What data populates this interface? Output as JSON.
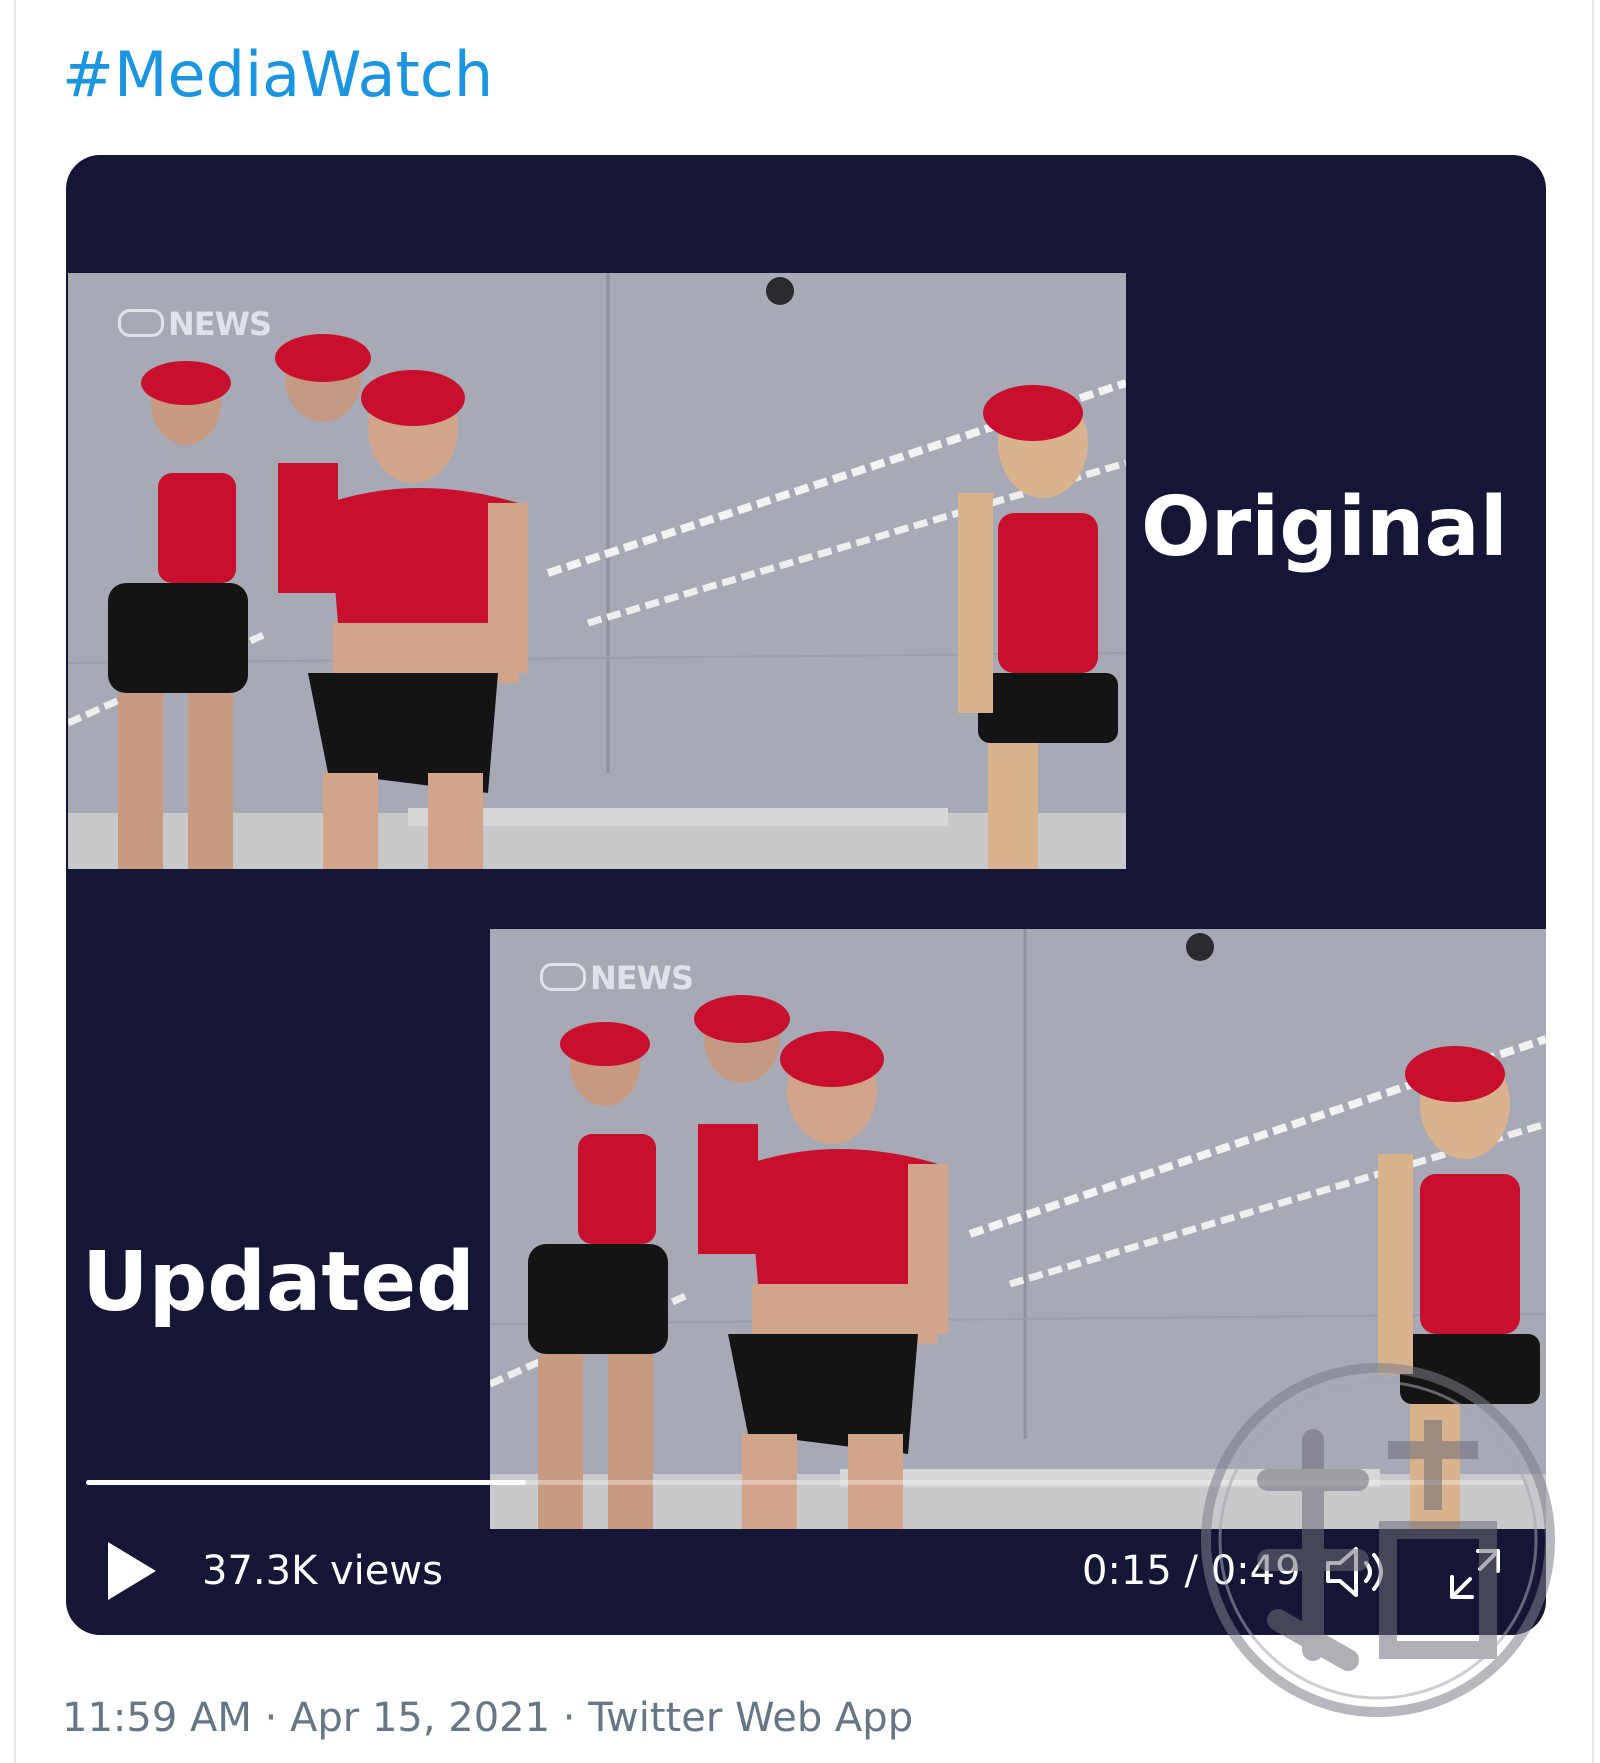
{
  "tweet": {
    "hashtag": "#MediaWatch",
    "timestamp": "11:59 AM",
    "date": "Apr 15, 2021",
    "source": "Twitter Web App",
    "separator": " · "
  },
  "video": {
    "label_top": "Original",
    "label_bottom": "Updated",
    "watermark_top": "NEWS",
    "watermark_bottom": "NEWS",
    "views": "37.3K views",
    "current_time": "0:15",
    "duration": "0:49",
    "time_separator": " / ",
    "progress_fraction": 0.306,
    "icons": [
      "play-icon",
      "volume-icon",
      "fullscreen-icon"
    ]
  },
  "colors": {
    "link": "#1b95e0",
    "meta": "#657786",
    "video_bg": "#151536",
    "beret": "#c8102e"
  }
}
